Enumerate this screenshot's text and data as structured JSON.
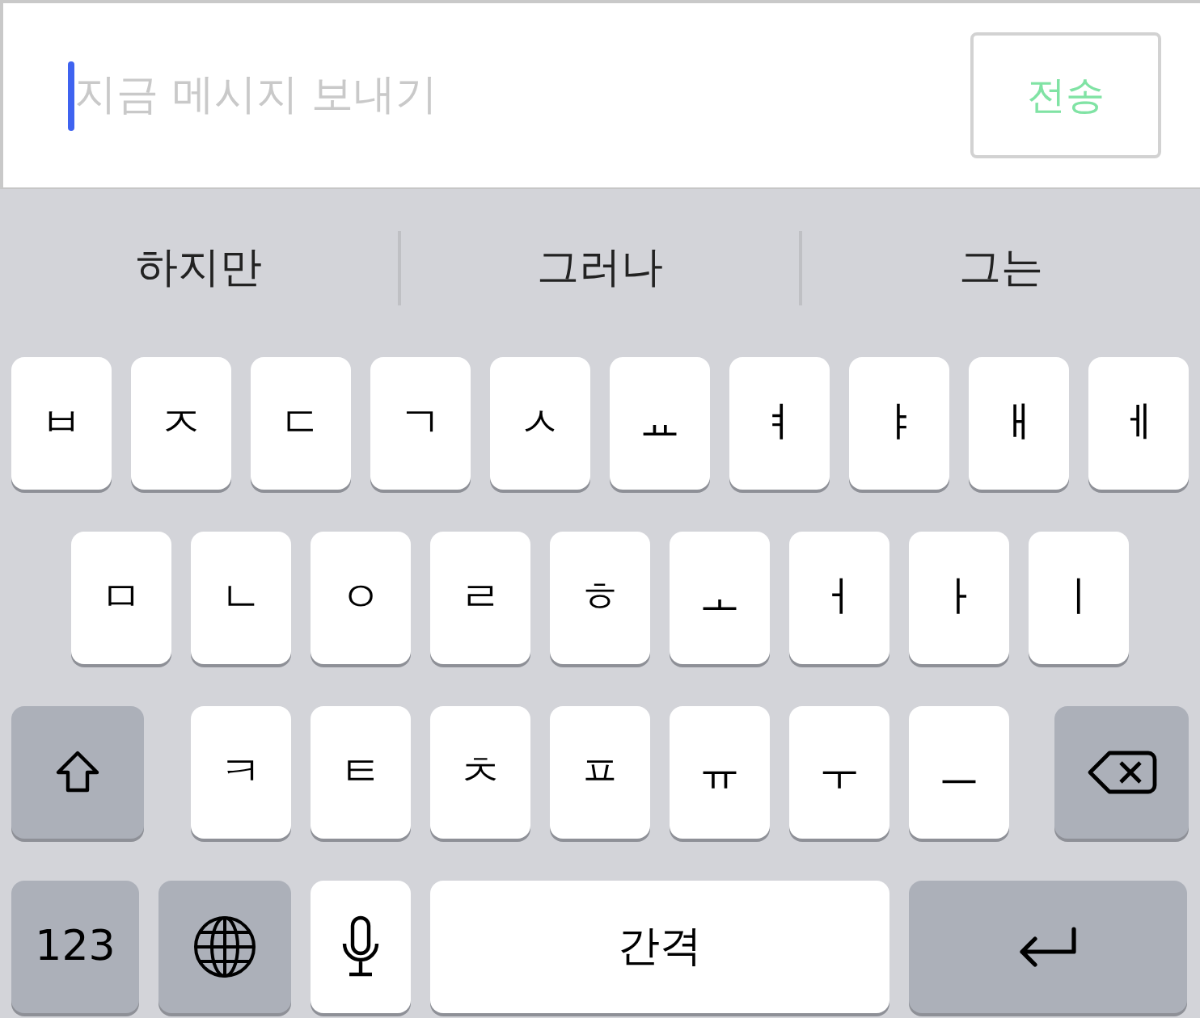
{
  "message_field": {
    "placeholder": "지금 메시지 보내기"
  },
  "send_button": {
    "label": "전송",
    "disabled": true
  },
  "suggestions": [
    "하지만",
    "그러나",
    "그는"
  ],
  "keyboard": {
    "rows": [
      [
        {
          "kind": "letter",
          "label": "ㅂ"
        },
        {
          "kind": "letter",
          "label": "ㅈ"
        },
        {
          "kind": "letter",
          "label": "ㄷ"
        },
        {
          "kind": "letter",
          "label": "ㄱ"
        },
        {
          "kind": "letter",
          "label": "ㅅ"
        },
        {
          "kind": "letter",
          "label": "ㅛ"
        },
        {
          "kind": "letter",
          "label": "ㅕ"
        },
        {
          "kind": "letter",
          "label": "ㅑ"
        },
        {
          "kind": "letter",
          "label": "ㅐ"
        },
        {
          "kind": "letter",
          "label": "ㅔ"
        }
      ],
      [
        {
          "kind": "letter",
          "label": "ㅁ"
        },
        {
          "kind": "letter",
          "label": "ㄴ"
        },
        {
          "kind": "letter",
          "label": "ㅇ"
        },
        {
          "kind": "letter",
          "label": "ㄹ"
        },
        {
          "kind": "letter",
          "label": "ㅎ"
        },
        {
          "kind": "letter",
          "label": "ㅗ"
        },
        {
          "kind": "letter",
          "label": "ㅓ"
        },
        {
          "kind": "letter",
          "label": "ㅏ"
        },
        {
          "kind": "letter",
          "label": "ㅣ"
        }
      ],
      [
        {
          "kind": "shift"
        },
        {
          "kind": "letter",
          "label": "ㅋ"
        },
        {
          "kind": "letter",
          "label": "ㅌ"
        },
        {
          "kind": "letter",
          "label": "ㅊ"
        },
        {
          "kind": "letter",
          "label": "ㅍ"
        },
        {
          "kind": "letter",
          "label": "ㅠ"
        },
        {
          "kind": "letter",
          "label": "ㅜ"
        },
        {
          "kind": "letter",
          "label": "ㅡ"
        },
        {
          "kind": "backspace"
        }
      ],
      [
        {
          "kind": "numbers",
          "label": "123"
        },
        {
          "kind": "globe"
        },
        {
          "kind": "mic"
        },
        {
          "kind": "space",
          "label": "간격"
        },
        {
          "kind": "return"
        }
      ]
    ]
  }
}
